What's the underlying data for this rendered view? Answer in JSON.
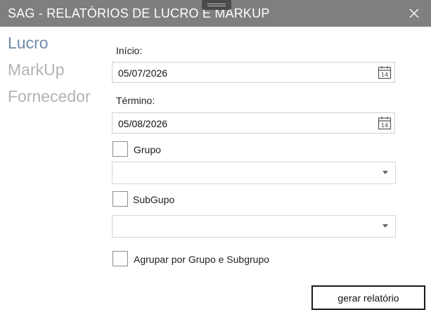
{
  "window": {
    "title": "SAG - RELATÓRIOS DE LUCRO E MARKUP",
    "icons": {
      "close": "close-icon",
      "grip": "drag-grip-icon"
    }
  },
  "nav": {
    "items": [
      {
        "label": "Lucro",
        "active": true
      },
      {
        "label": "MarkUp",
        "active": false
      },
      {
        "label": "Fornecedor",
        "active": false
      }
    ]
  },
  "form": {
    "inicio": {
      "label": "Início:",
      "value": "05/07/2026",
      "icon": "calendar-icon",
      "calendar_day": "14"
    },
    "termino": {
      "label": "Término:",
      "value": "05/08/2026",
      "icon": "calendar-icon",
      "calendar_day": "14"
    },
    "grupo": {
      "label": "Grupo",
      "checked": false,
      "selected": ""
    },
    "subgrupo": {
      "label": "SubGupo",
      "checked": false,
      "selected": ""
    },
    "agrupar": {
      "label": "Agrupar por Grupo e Subgrupo",
      "checked": false
    },
    "submit_label": "gerar relatório"
  },
  "colors": {
    "titlebar_bg": "#7f7f7f",
    "nav_active": "#6f8aa6",
    "nav_inactive": "#b3b3b3"
  }
}
